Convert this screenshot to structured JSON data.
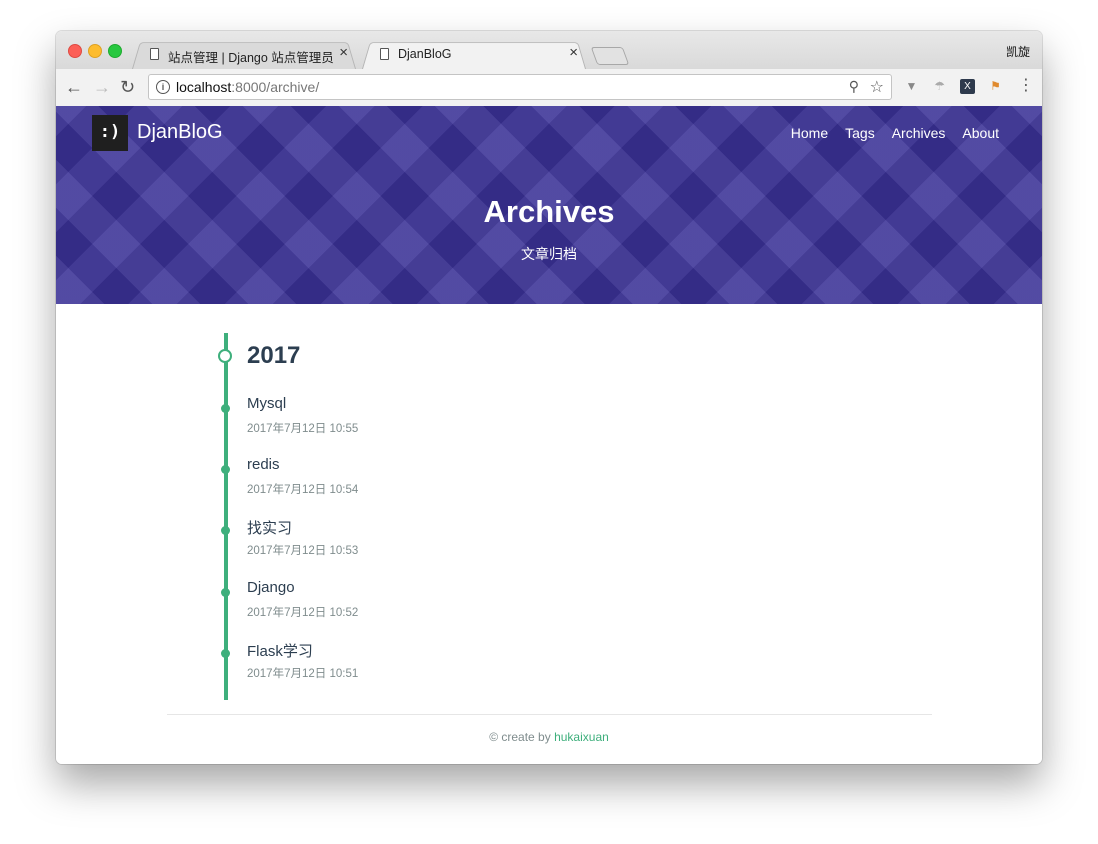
{
  "browser": {
    "tabs": [
      {
        "title": "站点管理 | Django 站点管理员",
        "close": "×"
      },
      {
        "title": "DjanBloG",
        "close": "×"
      }
    ],
    "profile_name": "凯旋",
    "url_host": "localhost",
    "url_rest": ":8000/archive/",
    "ext_x_label": "X"
  },
  "site": {
    "logo": ":)",
    "brand": "DjanBloG",
    "nav": [
      "Home",
      "Tags",
      "Archives",
      "About"
    ]
  },
  "hero": {
    "title": "Archives",
    "subtitle": "文章归档"
  },
  "archive": {
    "year": "2017",
    "posts": [
      {
        "title": "Mysql",
        "date": "2017年7月12日 10:55"
      },
      {
        "title": "redis",
        "date": "2017年7月12日 10:54"
      },
      {
        "title": "找实习",
        "date": "2017年7月12日 10:53"
      },
      {
        "title": "Django",
        "date": "2017年7月12日 10:52"
      },
      {
        "title": "Flask学习",
        "date": "2017年7月12日 10:51"
      }
    ]
  },
  "footer": {
    "prefix": "© create by",
    "author": "hukaixuan"
  }
}
